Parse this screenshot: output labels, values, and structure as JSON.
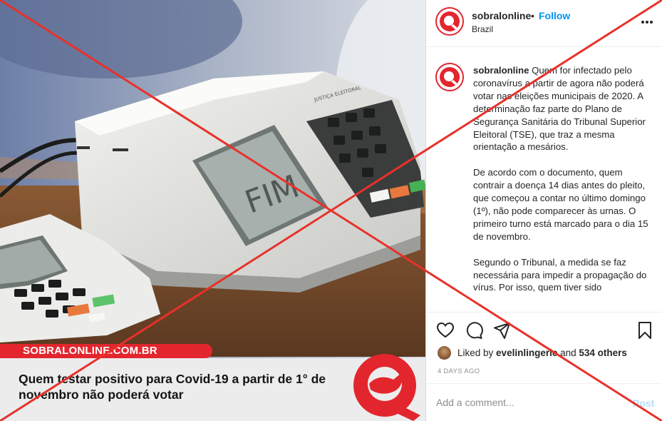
{
  "post": {
    "site_strip": "SOBRALONLINE.COM.BR",
    "headline": "Quem testar positivo para Covid-19 a partir de 1° de novembro não poderá votar",
    "screen_text": "FIM",
    "machine_label": "JUSTIÇA ELEITORAL"
  },
  "header": {
    "username": "sobralonline",
    "dot": "•",
    "follow_label": "Follow",
    "location": "Brazil",
    "more_icon": "more-horizontal-icon"
  },
  "caption": {
    "username": "sobralonline",
    "p1": "Quem for infectado pelo coronavírus a partir de agora não poderá votar nas eleições municipais de 2020. A determinação faz parte do Plano de Segurança Sanitária do Tribunal Superior Eleitoral (TSE), que traz a mesma orientação a mesários.",
    "p2": "De acordo com o documento, quem contrair a doença 14 dias antes do pleito, que começou a contar no último domingo (1º), não pode comparecer às urnas. O primeiro turno está marcado para o dia 15 de novembro.",
    "p3": "Segundo o Tribunal, a medida se faz necessária para impedir a propagação do vírus. Por isso, quem tiver sido"
  },
  "actions": {
    "icons": [
      "heart-icon",
      "comment-icon",
      "share-icon",
      "bookmark-icon"
    ]
  },
  "likes": {
    "prefix": "Liked by ",
    "user": "evelinlingerie",
    "middle": " and ",
    "count": "534 others"
  },
  "timestamp": "4 DAYS AGO",
  "comment_box": {
    "placeholder": "Add a comment...",
    "post_label": "Post"
  },
  "colors": {
    "brand_red": "#e3262e",
    "follow_blue": "#0095f6",
    "overlay_x": "#e8312a"
  }
}
